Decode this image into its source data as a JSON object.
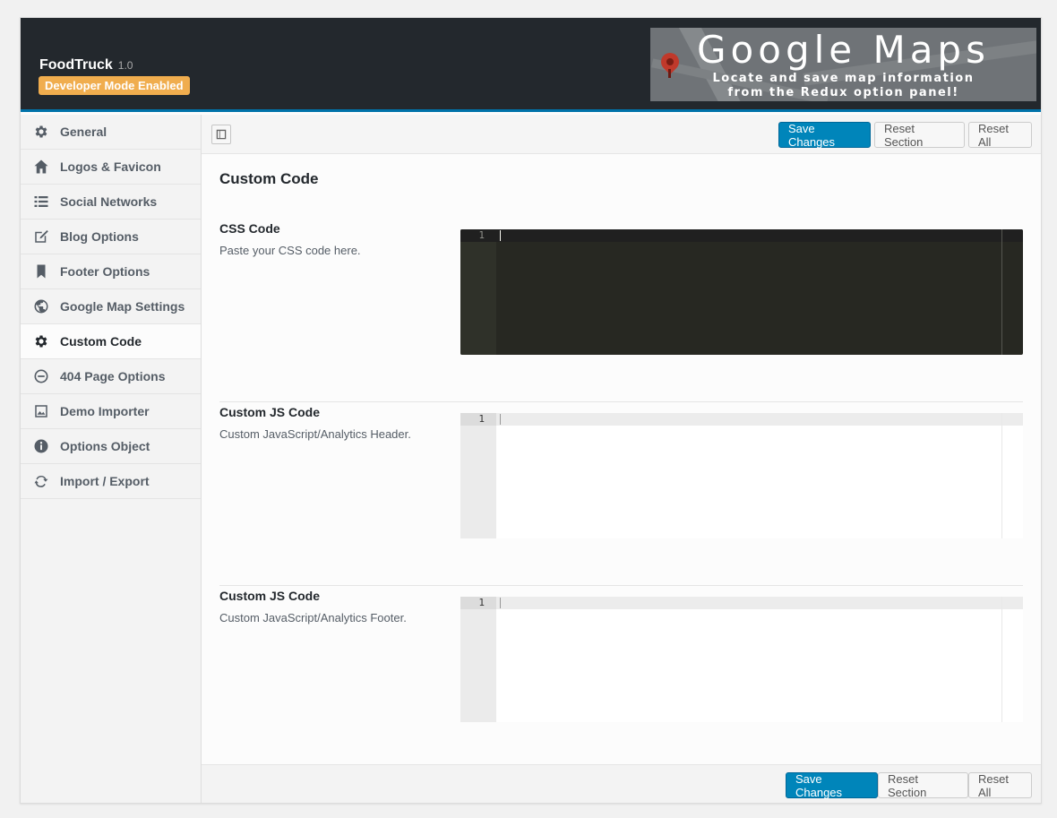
{
  "header": {
    "app_name": "FoodTruck",
    "version": "1.0",
    "dev_badge": "Developer Mode Enabled",
    "banner": {
      "title": "Google Maps",
      "subtitle_line1": "Locate and save map information",
      "subtitle_line2": "from the Redux option panel!"
    }
  },
  "sidebar": {
    "items": [
      {
        "label": "General",
        "icon": "gear-icon"
      },
      {
        "label": "Logos & Favicon",
        "icon": "home-icon"
      },
      {
        "label": "Social Networks",
        "icon": "list-icon"
      },
      {
        "label": "Blog Options",
        "icon": "edit-icon"
      },
      {
        "label": "Footer Options",
        "icon": "bookmark-icon"
      },
      {
        "label": "Google Map Settings",
        "icon": "globe-icon"
      },
      {
        "label": "Custom Code",
        "icon": "gear-icon",
        "active": true
      },
      {
        "label": "404 Page Options",
        "icon": "minus-circle-icon"
      },
      {
        "label": "Demo Importer",
        "icon": "image-icon"
      },
      {
        "label": "Options Object",
        "icon": "info-icon"
      },
      {
        "label": "Import / Export",
        "icon": "refresh-icon"
      }
    ]
  },
  "toolbar": {
    "save_label": "Save Changes",
    "reset_section_label": "Reset Section",
    "reset_all_label": "Reset All"
  },
  "main": {
    "section_title": "Custom Code",
    "fields": [
      {
        "title": "CSS Code",
        "description": "Paste your CSS code here.",
        "editor_theme": "dark",
        "line_number": "1",
        "value": ""
      },
      {
        "title": "Custom JS Code",
        "description": "Custom JavaScript/Analytics Header.",
        "editor_theme": "light",
        "line_number": "1",
        "value": ""
      },
      {
        "title": "Custom JS Code",
        "description": "Custom JavaScript/Analytics Footer.",
        "editor_theme": "light",
        "line_number": "1",
        "value": ""
      }
    ]
  },
  "footer": {
    "save_label": "Save Changes",
    "reset_section_label": "Reset Section",
    "reset_all_label": "Reset All"
  },
  "colors": {
    "accent": "#0085ba",
    "header_bg": "#23282d",
    "badge": "#f0ad4e"
  }
}
